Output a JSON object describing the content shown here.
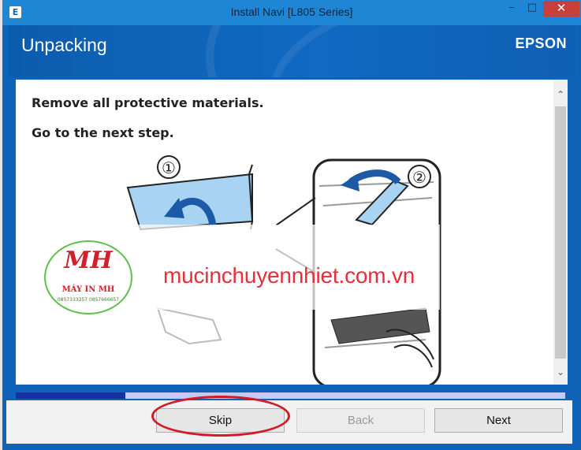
{
  "window": {
    "title": "Install Navi [L805 Series]",
    "app_icon": "E",
    "controls": {
      "minimize": "–",
      "maximize": "□",
      "close": "✕"
    }
  },
  "header": {
    "page_title": "Unpacking",
    "brand": "EPSON"
  },
  "content": {
    "instructions": [
      "Remove all protective materials.",
      "Go to the next step."
    ],
    "illustration": {
      "steps": [
        "①",
        "②"
      ]
    },
    "scrollbar": {
      "up_glyph": "⌃",
      "down_glyph": "⌄"
    }
  },
  "progress": {
    "fraction": 0.2
  },
  "footer": {
    "skip_label": "Skip",
    "back_label": "Back",
    "next_label": "Next",
    "back_enabled": false
  },
  "watermark": {
    "logo_initials": "MH",
    "logo_name": "MÁY IN MH",
    "logo_phones": "0857333357  0857666657",
    "url": "mucinchuyennhiet.com.vn"
  },
  "colors": {
    "title_bar": "#1f86d6",
    "header_bg": "#1169c3",
    "progress_fill": "#1b2fa0",
    "progress_track": "#c4cbf0",
    "annotation_ring": "#d3192a",
    "watermark_text": "#e3303b"
  }
}
